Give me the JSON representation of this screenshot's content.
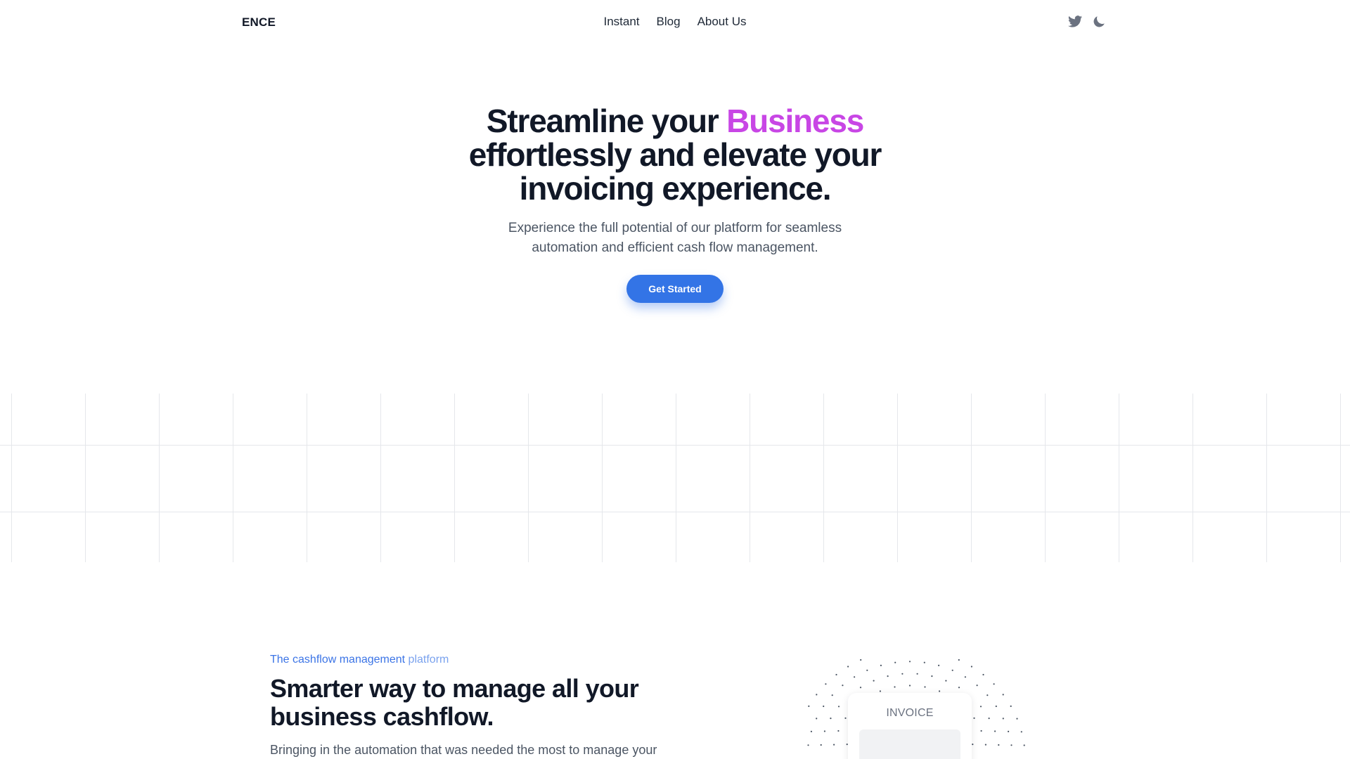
{
  "brand": {
    "name": "ENCE"
  },
  "nav": {
    "links": [
      "Instant",
      "Blog",
      "About Us"
    ],
    "icons": [
      "twitter-icon",
      "moon-icon"
    ]
  },
  "hero": {
    "title_part1": "Streamline your ",
    "title_accent": "Business",
    "title_part2": "effortlessly and elevate your",
    "title_part3": "invoicing experience.",
    "subtitle_line1": "Experience the full potential of our platform for seamless",
    "subtitle_line2": "automation and efficient cash flow management.",
    "cta_label": "Get Started"
  },
  "feature": {
    "eyebrow_main": "The cashflow management",
    "eyebrow_fade": " platform",
    "title_line1": "Smarter way to manage all your",
    "title_line2": "business cashflow.",
    "description": "Bringing in the automation that was needed the most to manage your"
  },
  "illustration": {
    "card_label": "INVOICE"
  },
  "colors": {
    "accent": "#c846e5",
    "primary": "#3374e6",
    "text": "#111827",
    "muted": "#4b5563",
    "grid": "#e5e7eb"
  }
}
